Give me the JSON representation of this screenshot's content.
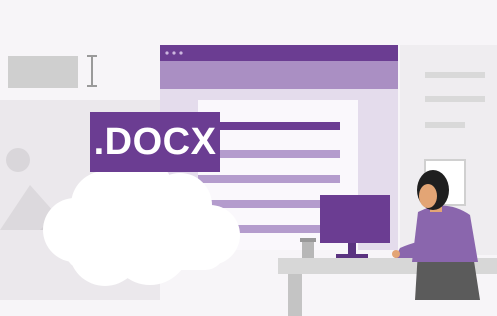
{
  "badge": {
    "label": ".DOCX"
  },
  "colors": {
    "background": "#f7f5f8",
    "accent_purple": "#6b3d92",
    "light_purple": "#d9cde6",
    "document_bg": "#e4dcec",
    "cloud": "#ffffff",
    "desk": "#d7d7d7"
  },
  "icons": [
    "text-cursor-icon",
    "cloud-icon",
    "computer-monitor-icon",
    "coffee-cup-icon"
  ]
}
